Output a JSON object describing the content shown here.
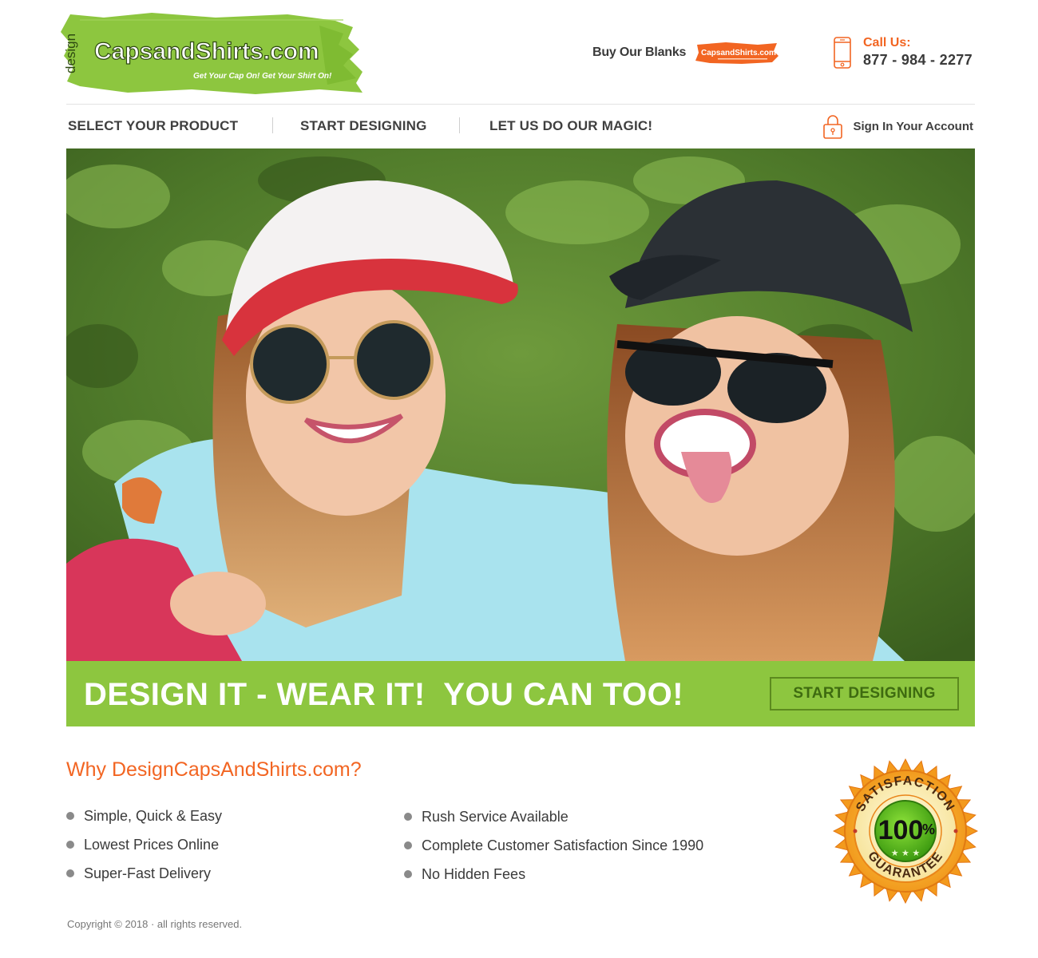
{
  "brand": {
    "logo_prefix": "design",
    "logo_name": "CapsandShirts.com",
    "tagline": "Get Your Cap On! Get Your Shirt On!",
    "accent": "#8dc63f",
    "orange": "#f26522"
  },
  "header": {
    "blanks_label": "Buy Our Blanks",
    "blanks_logo_text": "CapsandShirts.com",
    "call_label": "Call Us:",
    "phone": "877 - 984 - 2277",
    "phone_icon": "mobile-phone-icon"
  },
  "nav": {
    "items": [
      {
        "label": "SELECT YOUR PRODUCT"
      },
      {
        "label": "START DESIGNING"
      },
      {
        "label": "LET US DO OUR MAGIC!"
      }
    ],
    "signin_label": "Sign In Your Account",
    "signin_icon": "padlock-icon"
  },
  "hero": {
    "description_icon": "hero-photo"
  },
  "banner": {
    "headline": "DESIGN IT - WEAR IT!  YOU CAN TOO!",
    "button_label": "START DESIGNING"
  },
  "why": {
    "title": "Why DesignCapsAndShirts.com?",
    "col1": [
      "Simple, Quick & Easy",
      "Lowest Prices Online",
      "Super-Fast Delivery"
    ],
    "col2": [
      "Rush Service Available",
      "Complete Customer Satisfaction Since 1990",
      "No Hidden Fees"
    ]
  },
  "badge": {
    "top_text": "SATISFACTION",
    "value": "100",
    "percent": "%",
    "bottom_text": "GUARANTEE"
  },
  "footer": {
    "copyright": "Copyright © 2018 · all rights reserved."
  }
}
